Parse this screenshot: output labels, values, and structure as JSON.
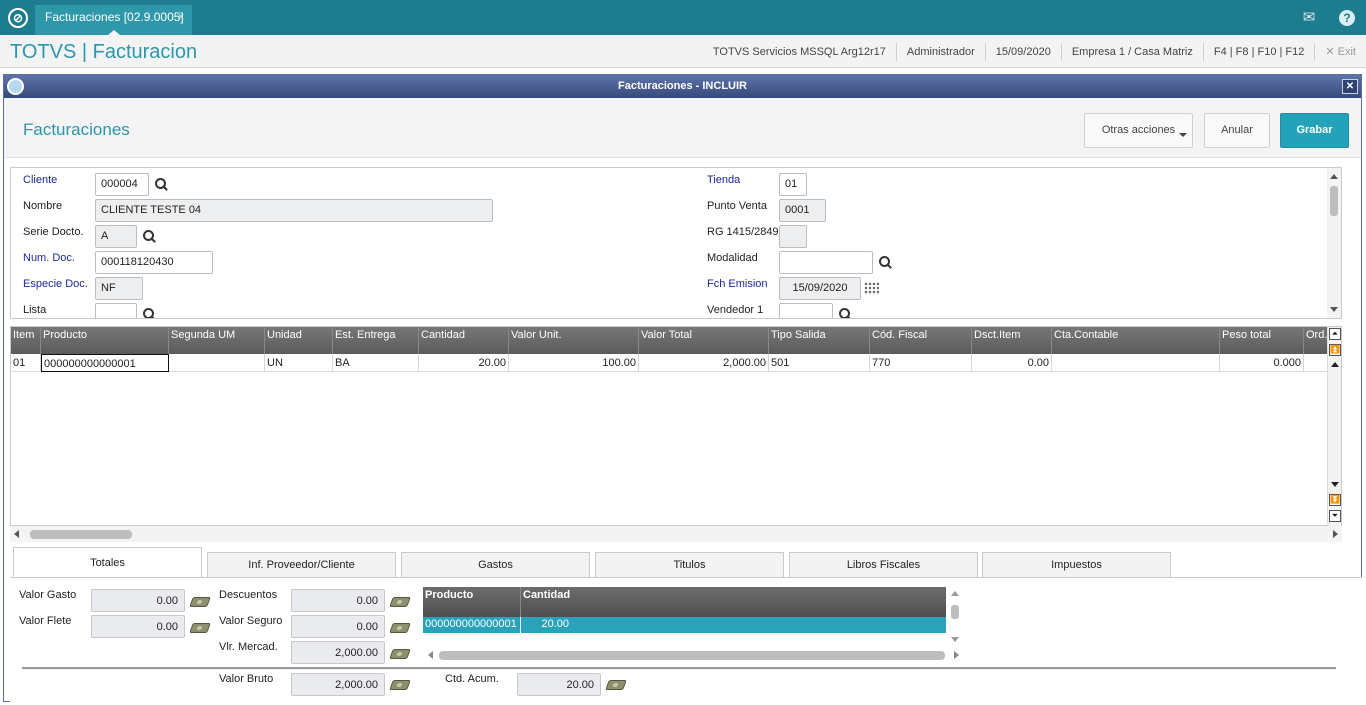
{
  "topbar": {
    "tab_label": "Facturaciones [02.9.0005]",
    "tab_close": "×",
    "mail_icon": "mail-icon",
    "help_icon": "help-icon"
  },
  "header": {
    "brand": "TOTVS | Facturacion",
    "server": "TOTVS Servicios MSSQL Arg12r17",
    "user": "Administrador",
    "date": "15/09/2020",
    "company": "Empresa 1 / Casa Matriz",
    "shortcuts": "F4 | F8 | F10 | F12",
    "exit": "✕  Exit"
  },
  "window": {
    "title": "Facturaciones - INCLUIR",
    "close": "✕"
  },
  "toolbar": {
    "page_title": "Facturaciones",
    "otras": "Otras acciones",
    "anular": "Anular",
    "grabar": "Grabar"
  },
  "form": {
    "cliente_label": "Cliente",
    "cliente_value": "000004",
    "nombre_label": "Nombre",
    "nombre_value": "CLIENTE TESTE 04",
    "serie_label": "Serie Docto.",
    "serie_value": "A",
    "numdoc_label": "Num. Doc.",
    "numdoc_value": "000118120430",
    "especie_label": "Especie Doc.",
    "especie_value": "NF",
    "lista_label": "Lista",
    "lista_value": "",
    "tienda_label": "Tienda",
    "tienda_value": "01",
    "punto_label": "Punto Venta",
    "punto_value": "0001",
    "rg_label": "RG 1415/2849",
    "rg_value": "",
    "modalidad_label": "Modalidad",
    "modalidad_value": "",
    "fch_label": "Fch Emision",
    "fch_value": "15/09/2020",
    "vendedor_label": "Vendedor 1",
    "vendedor_value": ""
  },
  "grid": {
    "columns": [
      "Item",
      "Producto",
      "Segunda UM",
      "Unidad",
      "Est. Entrega",
      "Cantidad",
      "Valor Unit.",
      "Valor Total",
      "Tipo Salida",
      "Cód. Fiscal",
      "Dsct.Item",
      "Cta.Contable",
      "Peso total",
      "Ord. P"
    ],
    "row": [
      "01",
      "000000000000001",
      "",
      "UN",
      "BA",
      "20.00",
      "100.00",
      "2,000.00",
      "501",
      "770",
      "0.00",
      "",
      "0.000",
      ""
    ]
  },
  "tabs": [
    "Totales",
    "Inf. Proveedor/Cliente",
    "Gastos",
    "Titulos",
    "Libros Fiscales",
    "Impuestos"
  ],
  "totales": {
    "valor_gasto_label": "Valor Gasto",
    "valor_gasto": "0.00",
    "valor_flete_label": "Valor Flete",
    "valor_flete": "0.00",
    "descuentos_label": "Descuentos",
    "descuentos": "0.00",
    "valor_seguro_label": "Valor Seguro",
    "valor_seguro": "0.00",
    "vlr_mercad_label": "Vlr. Mercad.",
    "vlr_mercad": "2,000.00",
    "valor_bruto_label": "Valor Bruto",
    "valor_bruto": "2,000.00",
    "ctd_acum_label": "Ctd. Acum.",
    "ctd_acum": "20.00"
  },
  "subgrid": {
    "columns": [
      "Producto",
      "Cantidad"
    ],
    "row": [
      "000000000000001",
      "20.00"
    ]
  }
}
